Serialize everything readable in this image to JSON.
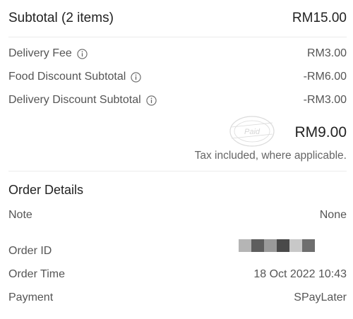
{
  "summary": {
    "subtotal_label": "Subtotal (2 items)",
    "subtotal_value": "RM15.00",
    "delivery_fee_label": "Delivery Fee",
    "delivery_fee_value": "RM3.00",
    "food_discount_label": "Food Discount Subtotal",
    "food_discount_value": "-RM6.00",
    "delivery_discount_label": "Delivery Discount Subtotal",
    "delivery_discount_value": "-RM3.00",
    "total_value": "RM9.00",
    "tax_note": "Tax included, where applicable.",
    "stamp_text": "Paid"
  },
  "order_details": {
    "title": "Order Details",
    "note_label": "Note",
    "note_value": "None",
    "order_id_label": "Order ID",
    "order_time_label": "Order Time",
    "order_time_value": "18 Oct 2022 10:43",
    "payment_label": "Payment",
    "payment_value": "SPayLater"
  },
  "colors": {
    "redaction_blocks": [
      "#b5b5b5",
      "#5e5e5e",
      "#9a9a9a",
      "#4a4a4a",
      "#c8c8c8",
      "#6e6e6e"
    ]
  }
}
